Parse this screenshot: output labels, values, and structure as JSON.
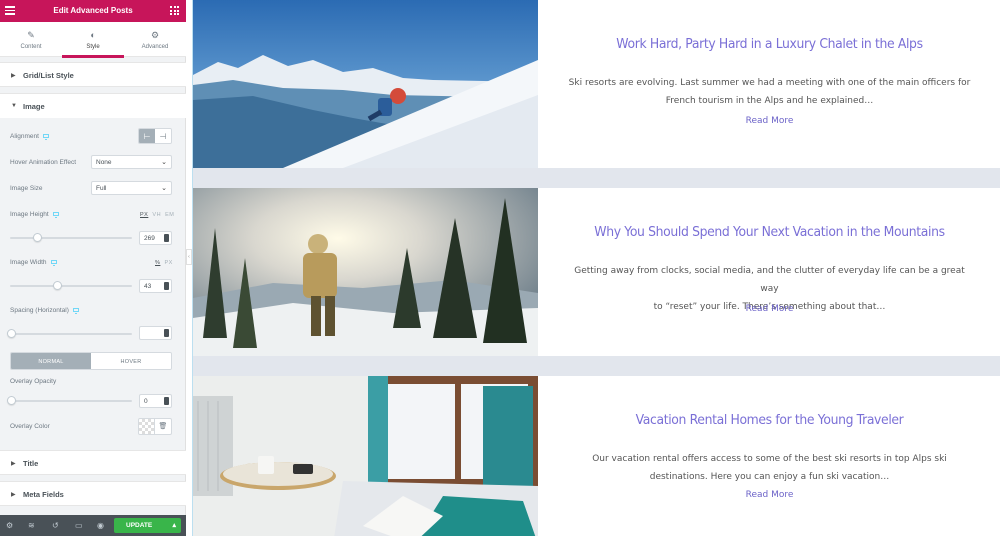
{
  "panel": {
    "title": "Edit Advanced Posts",
    "tabs": [
      {
        "label": "Content",
        "icon": "pencil-icon"
      },
      {
        "label": "Style",
        "icon": "half-circle-icon"
      },
      {
        "label": "Advanced",
        "icon": "gear-icon"
      }
    ],
    "active_tab": "Style",
    "sections": {
      "grid_list": "Grid/List Style",
      "image": "Image",
      "title": "Title",
      "meta": "Meta Fields"
    },
    "controls": {
      "alignment_label": "Alignment",
      "hover_label": "Hover Animation Effect",
      "hover_value": "None",
      "size_label": "Image Size",
      "size_value": "Full",
      "height_label": "Image Height",
      "height_units": [
        "PX",
        "VH",
        "EM"
      ],
      "height_value": "269",
      "height_level": 0.2,
      "width_label": "Image Width",
      "width_units": [
        "%",
        "PX"
      ],
      "width_value": "43",
      "width_level": 0.38,
      "spacing_label": "Spacing (Horizontal)",
      "spacing_value": "",
      "normal_label": "NORMAL",
      "hover_tab_label": "HOVER",
      "opacity_label": "Overlay Opacity",
      "opacity_value": "0",
      "color_label": "Overlay Color"
    },
    "update_label": "UPDATE",
    "accent": "#c7155a",
    "update_color": "#39b54a"
  },
  "posts": [
    {
      "title": "Work Hard, Party Hard in a Luxury Chalet in the Alps",
      "excerpt_lines": [
        "Ski resorts are evolving. Last summer we had a meeting with one of the main officers for",
        "French tourism in the Alps and he explained…"
      ],
      "read_more": "Read More"
    },
    {
      "title": "Why You Should Spend Your Next Vacation in the Mountains",
      "excerpt_lines": [
        "Getting away from clocks, social media, and the clutter of everyday life can be a great way",
        "to “reset” your life. There’s something about that…"
      ],
      "read_more": "Read More"
    },
    {
      "title": "Vacation Rental Homes for the Young Traveler",
      "excerpt_lines": [
        "Our vacation rental offers access to some of the best ski resorts in top Alps ski",
        "destinations. Here you can enjoy a fun ski vacation…"
      ],
      "read_more": "Read More"
    }
  ],
  "colors": {
    "post_title": "#7a6fd6",
    "gap": "#e2e6ed"
  }
}
